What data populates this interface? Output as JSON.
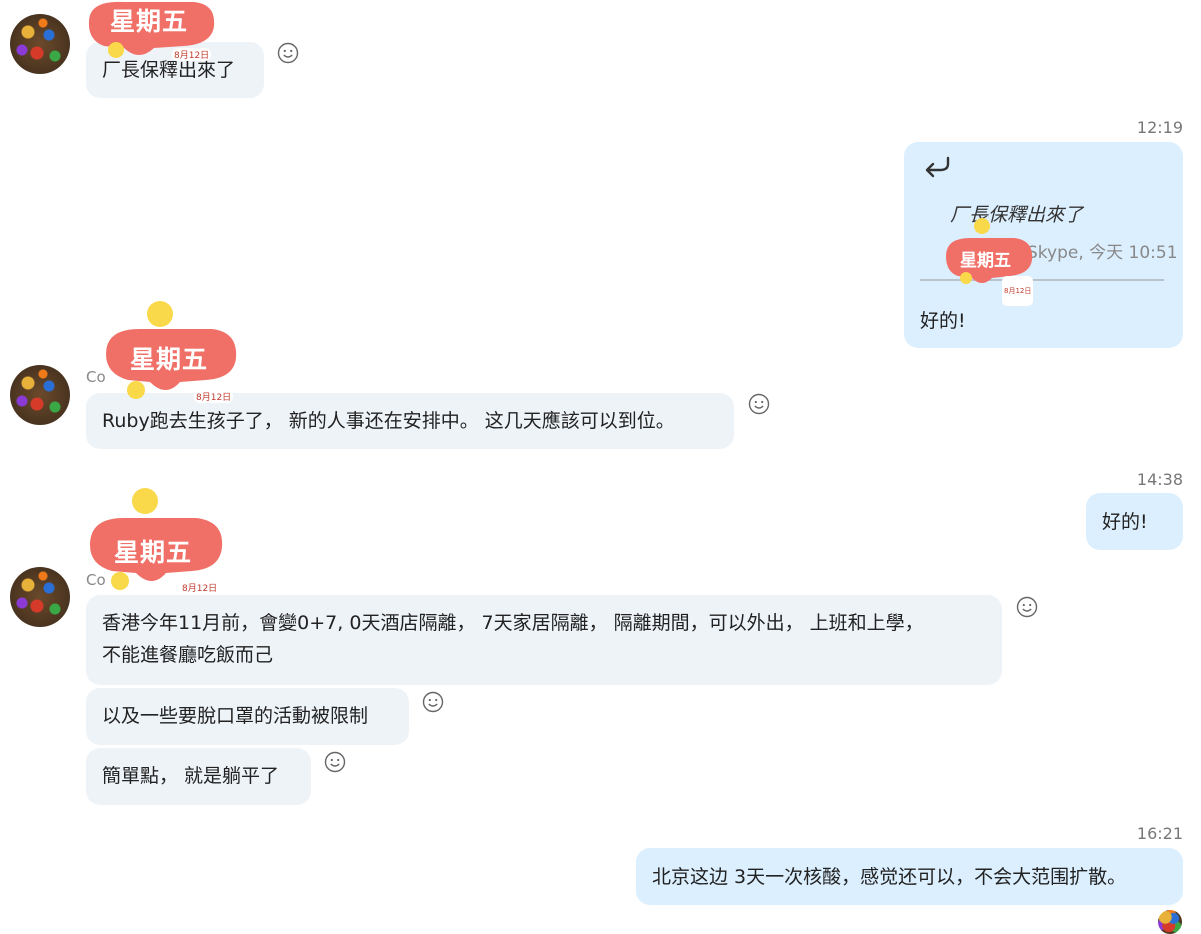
{
  "messages": {
    "m1": {
      "text": "厂長保釋出來了"
    },
    "t1": "12:19",
    "m2": {
      "reply_icon": "reply-arrow-icon",
      "quote_text": "厂長保釋出來了",
      "quote_meta": "Skype, 今天 10:51",
      "text": "好的!"
    },
    "m3": {
      "sender": "Co",
      "text": "Ruby跑去生孩子了， 新的人事还在安排中。 这几天應該可以到位。"
    },
    "t2": "14:38",
    "m4": {
      "text": "好的!"
    },
    "m5": {
      "sender": "Co",
      "line1": "香港今年11月前，會變0+7, 0天酒店隔離， 7天家居隔離， 隔離期間，可以外出， 上班和上學，",
      "line2": "不能進餐廳吃飯而己"
    },
    "m6": {
      "text": "以及一些要脫口罩的活動被限制"
    },
    "m7": {
      "text": "簡單點， 就是躺平了"
    },
    "t3": "16:21",
    "m8": {
      "text": "北京这边 3天一次核酸，感觉还可以，不会大范围扩散。"
    }
  },
  "stickers": {
    "day": "星期五",
    "date": "8月12日"
  },
  "colors": {
    "incoming_bubble": "#eef3f8",
    "outgoing_bubble": "#dcefff",
    "sticker_red": "#f07068"
  }
}
